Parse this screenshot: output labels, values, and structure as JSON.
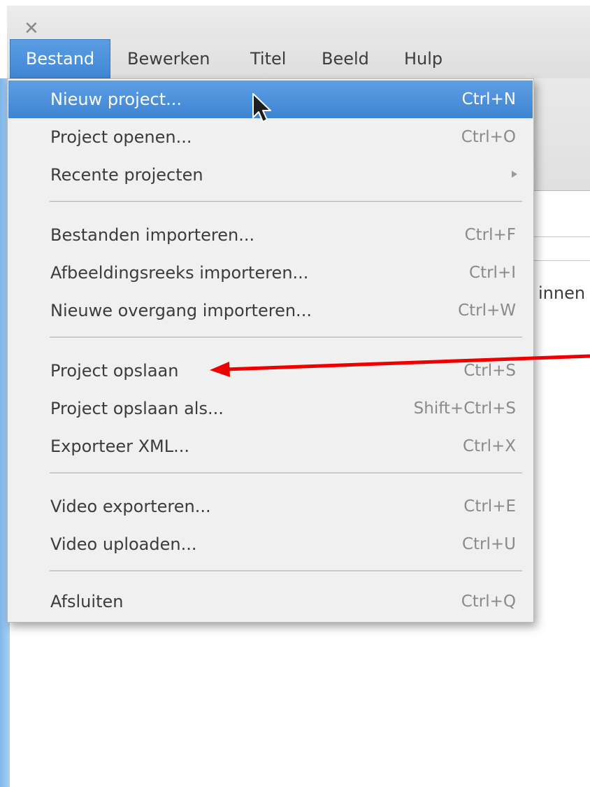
{
  "window": {
    "close_icon": "close-icon"
  },
  "menubar": {
    "items": [
      {
        "label": "Bestand",
        "active": true
      },
      {
        "label": "Bewerken"
      },
      {
        "label": "Titel"
      },
      {
        "label": "Beeld"
      },
      {
        "label": "Hulp"
      }
    ]
  },
  "background": {
    "partial_text": "innen"
  },
  "dropdown": {
    "items": [
      {
        "label": "Nieuw project...",
        "accel": "Ctrl+N",
        "highlighted": true
      },
      {
        "label": "Project openen...",
        "accel": "Ctrl+O"
      },
      {
        "label": "Recente projecten",
        "accel": ""
      },
      {
        "label": "Bestanden importeren...",
        "accel": "Ctrl+F"
      },
      {
        "label": "Afbeeldingsreeks importeren...",
        "accel": "Ctrl+I"
      },
      {
        "label": "Nieuwe overgang importeren...",
        "accel": "Ctrl+W"
      },
      {
        "label": "Project opslaan",
        "accel": "Ctrl+S"
      },
      {
        "label": "Project opslaan als...",
        "accel": "Shift+Ctrl+S"
      },
      {
        "label": "Exporteer XML...",
        "accel": "Ctrl+X"
      },
      {
        "label": "Video exporteren...",
        "accel": "Ctrl+E"
      },
      {
        "label": "Video uploaden...",
        "accel": "Ctrl+U"
      },
      {
        "label": "Afsluiten",
        "accel": "Ctrl+Q"
      }
    ]
  },
  "colors": {
    "highlight": "#4a90dc",
    "annotation_arrow": "#ee0000"
  }
}
